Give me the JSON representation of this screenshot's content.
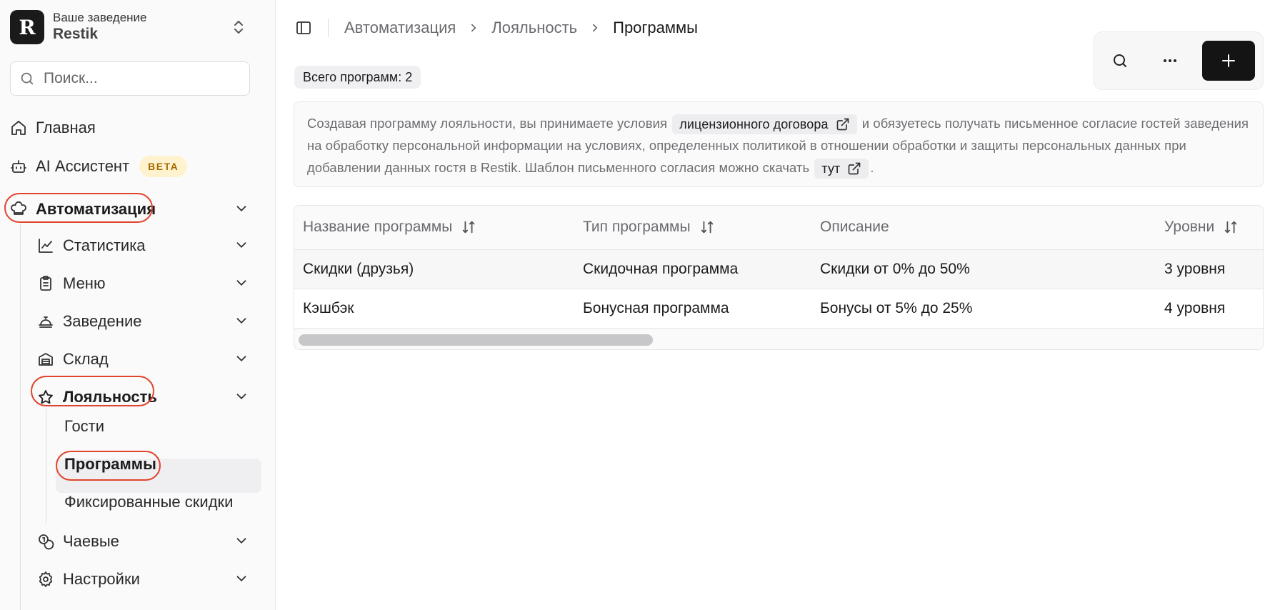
{
  "org": {
    "logo_letter": "R",
    "subtitle": "Ваше заведение",
    "name": "Restik"
  },
  "search": {
    "placeholder": "Поиск..."
  },
  "nav": {
    "home": "Главная",
    "ai": "AI Ассистент",
    "ai_badge": "BETA",
    "automation": "Автоматизация",
    "statistics": "Статистика",
    "menu": "Меню",
    "venue": "Заведение",
    "warehouse": "Склад",
    "loyalty": "Лояльность",
    "loyalty_children": [
      "Гости",
      "Программы",
      "Фиксированные скидки"
    ],
    "tips": "Чаевые",
    "settings": "Настройки"
  },
  "breadcrumb": {
    "items": [
      "Автоматизация",
      "Лояльность"
    ],
    "current": "Программы"
  },
  "summary": {
    "total_label": "Всего программ: 2"
  },
  "notice": {
    "part1": "Создавая программу лояльности, вы принимаете условия",
    "link1": "лицензионного договора",
    "part2": "и обязуетесь получать письменное согласие гостей заведения на обработку персональной информации на условиях, определенных политикой в отношении обработки и защиты персональных данных при добавлении данных гостя в Restik. Шаблон письменного согласия можно скачать",
    "link2": "тут",
    "part3": "."
  },
  "table": {
    "columns": [
      "Название программы",
      "Тип программы",
      "Описание",
      "Уровни"
    ],
    "rows": [
      [
        "Скидки (друзья)",
        "Скидочная программа",
        "Скидки от 0% до 50%",
        "3 уровня"
      ],
      [
        "Кэшбэк",
        "Бонусная программа",
        "Бонусы от 5% до 25%",
        "4 уровня"
      ]
    ]
  },
  "icons": {
    "home": "home-icon",
    "ai": "bot-icon",
    "automation": "chef-hat-icon",
    "statistics": "line-chart-icon",
    "menu": "clipboard-icon",
    "venue": "cloche-icon",
    "warehouse": "warehouse-icon",
    "loyalty": "star-icon",
    "tips": "coins-icon",
    "settings": "gear-icon"
  },
  "colors": {
    "accent_dark": "#141414",
    "highlight_circle": "#e0452c",
    "beta_bg": "#fff3cf",
    "beta_text": "#a56b00"
  }
}
